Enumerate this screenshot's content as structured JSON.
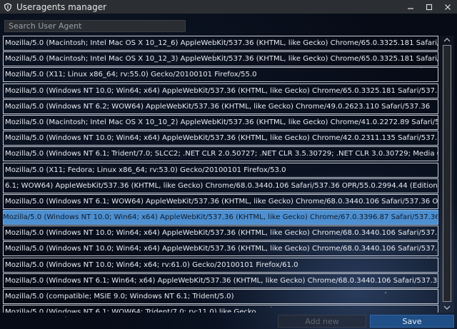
{
  "window": {
    "title": "Useragents manager"
  },
  "search": {
    "placeholder": "Search User Agent",
    "value": ""
  },
  "list": {
    "selected_index": 11,
    "items": [
      "Mozilla/5.0 (Macintosh; Intel Mac OS X 10_12_6) AppleWebKit/537.36 (KHTML, like Gecko) Chrome/65.0.3325.181 Safari/537.36",
      "Mozilla/5.0 (Macintosh; Intel Mac OS X 10_12_3) AppleWebKit/537.36 (KHTML, like Gecko) Chrome/65.0.3325.181 Safari/537.36",
      "Mozilla/5.0 (X11; Linux x86_64; rv:55.0) Gecko/20100101 Firefox/55.0",
      "Mozilla/5.0 (Windows NT 10.0; Win64; x64) AppleWebKit/537.36 (KHTML, like Gecko) Chrome/65.0.3325.181 Safari/537.36 OPR/5...",
      "Mozilla/5.0 (Windows NT 6.2; WOW64) AppleWebKit/537.36 (KHTML, like Gecko) Chrome/49.0.2623.110 Safari/537.36",
      "Mozilla/5.0 (Macintosh; Intel Mac OS X 10_10_2) AppleWebKit/537.36 (KHTML, like Gecko) Chrome/41.0.2272.89 Safari/537.36 OPR/2...",
      "Mozilla/5.0 (Windows NT 10.0; Win64; x64) AppleWebKit/537.36 (KHTML, like Gecko) Chrome/42.0.2311.135 Safari/537.36 Edge/1...",
      "Mozilla/5.0 (Windows NT 6.1; Trident/7.0; SLCC2; .NET CLR 2.0.50727; .NET CLR 3.5.30729; .NET CLR 3.0.30729; Media Center PC 6.0...",
      "Mozilla/5.0 (X11; Fedora; Linux x86_64; rv:53.0) Gecko/20100101 Firefox/53.0",
      "6.1; WOW64) AppleWebKit/537.36 (KHTML, like Gecko) Chrome/68.0.3440.106 Safari/537.36 OPR/55.0.2994.44 (Edition Campaign 75)",
      "Mozilla/5.0 (Windows NT 6.1; WOW64) AppleWebKit/537.36 (KHTML, like Gecko) Chrome/68.0.3440.106 Safari/537.36 OPR/55.0...",
      "Mozilla/5.0 (Windows NT 10.0; Win64; x64) AppleWebKit/537.36 (KHTML, like Gecko) Chrome/67.0.3396.87 Safari/537.36 OPR/54...",
      "Mozilla/5.0 (Windows NT 10.0; Win64; x64) AppleWebKit/537.36 (KHTML, like Gecko) Chrome/68.0.3440.106 Safari/537.36 OPR/55...",
      "Mozilla/5.0 (Windows NT 10.0; Win64; x64) AppleWebKit/537.36 (KHTML, like Gecko) Chrome/68.0.3440.106 Safari/537.36",
      "Mozilla/5.0 (Windows NT 10.0; Win64; x64; rv:61.0) Gecko/20100101 Firefox/61.0",
      "Mozilla/5.0 (Windows NT 6.1; Win64; x64) AppleWebKit/537.36 (KHTML, like Gecko) Chrome/68.0.3440.106 Safari/537.36",
      "Mozilla/5.0 (compatible; MSIE 9.0; Windows NT 6.1; Trident/5.0)",
      "Mozilla/5.0 (Windows NT 6.1; WOW64; Trident/7.0; rv:11.0) like Gecko"
    ]
  },
  "buttons": {
    "add_new": "Add new",
    "save": "Save"
  },
  "icons": {
    "app": "shield-icon",
    "minimize": "minimize-icon",
    "maximize": "maximize-icon",
    "close": "close-icon",
    "scroll_up": "chevron-up-icon",
    "scroll_down": "chevron-down-icon"
  },
  "colors": {
    "selection": "#4d8fd0",
    "save_button": "#1f4f86",
    "titlebar": "#2b2e33"
  }
}
